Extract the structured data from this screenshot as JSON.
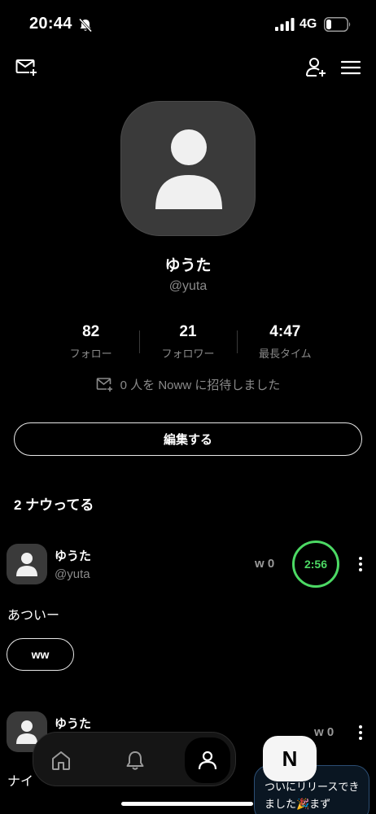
{
  "status_bar": {
    "time": "20:44",
    "network": "4G"
  },
  "profile": {
    "display_name": "ゆうた",
    "handle": "@yuta",
    "stats": [
      {
        "value": "82",
        "label": "フォロー"
      },
      {
        "value": "21",
        "label": "フォロワー"
      },
      {
        "value": "4:47",
        "label": "最長タイム"
      }
    ],
    "invite_text": "0 人を Noww に招待しました",
    "edit_label": "編集する"
  },
  "section": {
    "title": "2 ナウってる"
  },
  "posts": [
    {
      "name": "ゆうた",
      "handle": "@yuta",
      "reactions": "w 0",
      "timer": "2:56",
      "text": "あついー",
      "chip": "ww"
    },
    {
      "name": "ゆうた",
      "reactions": "w 0",
      "text": "ナイ"
    }
  ],
  "promo": {
    "badge": "N",
    "text": "ついにリリースできました🎉まず"
  },
  "icons": {
    "status": [
      "bell-off-icon",
      "signal-icon",
      "battery-icon"
    ],
    "header": [
      "mail-plus-icon",
      "user-plus-icon",
      "menu-icon"
    ],
    "tabs": [
      "home-icon",
      "bell-icon",
      "user-icon"
    ]
  },
  "colors": {
    "background": "#000000",
    "accent_timer": "#4cd964",
    "muted_text": "#8a8a8a",
    "promo_border": "#2c4e74"
  }
}
